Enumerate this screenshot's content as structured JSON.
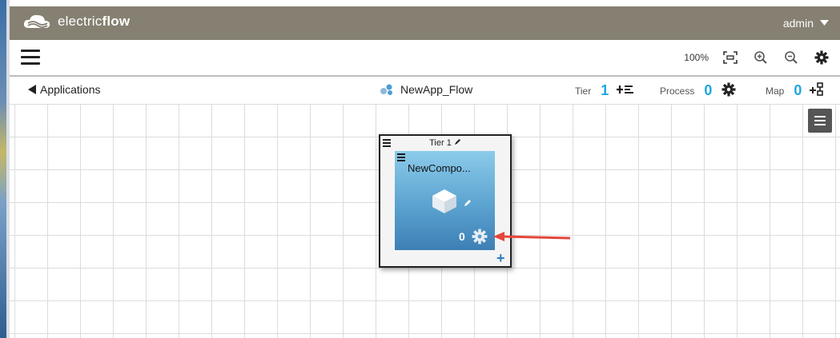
{
  "header": {
    "brand_light": "electric",
    "brand_bold": "flow",
    "user": "admin",
    "bar_color": "#858072"
  },
  "toolbar": {
    "zoom_level": "100%",
    "icons": [
      "menu-icon",
      "fit-to-screen-icon",
      "zoom-in-icon",
      "zoom-out-icon",
      "gear-icon"
    ]
  },
  "infobar": {
    "back_label": "Applications",
    "app_name": "NewApp_Flow",
    "tier_label": "Tier",
    "tier_count": "1",
    "process_label": "Process",
    "process_count": "0",
    "map_label": "Map",
    "map_count": "0",
    "accent_color": "#1fa6e0"
  },
  "tier_card": {
    "title": "Tier 1",
    "component": {
      "name": "NewCompo...",
      "process_count": "0"
    }
  }
}
